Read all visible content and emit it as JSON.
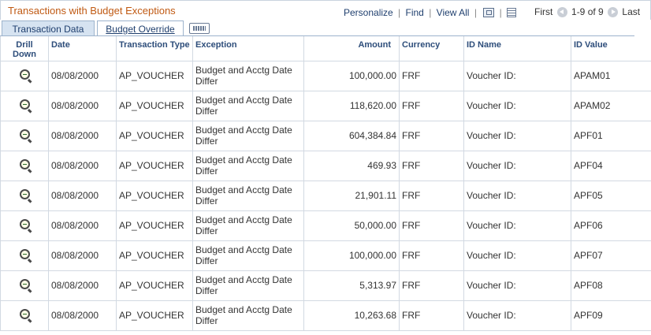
{
  "header": {
    "title": "Transactions with Budget Exceptions",
    "personalize": "Personalize",
    "find": "Find",
    "view_all": "View All",
    "first": "First",
    "range": "1-9 of 9",
    "last": "Last"
  },
  "tabs": [
    {
      "label": "Transaction Data"
    },
    {
      "label": "Budget Override"
    }
  ],
  "columns": {
    "drill": "Drill Down",
    "date": "Date",
    "type": "Transaction Type",
    "exception": "Exception",
    "amount": "Amount",
    "currency": "Currency",
    "id_name": "ID Name",
    "id_value": "ID Value"
  },
  "rows": [
    {
      "date": "08/08/2000",
      "type": "AP_VOUCHER",
      "exception": "Budget and Acctg Date Differ",
      "amount": "100,000.00",
      "currency": "FRF",
      "id_name": "Voucher ID:",
      "id_value": "APAM01"
    },
    {
      "date": "08/08/2000",
      "type": "AP_VOUCHER",
      "exception": "Budget and Acctg Date Differ",
      "amount": "118,620.00",
      "currency": "FRF",
      "id_name": "Voucher ID:",
      "id_value": "APAM02"
    },
    {
      "date": "08/08/2000",
      "type": "AP_VOUCHER",
      "exception": "Budget and Acctg Date Differ",
      "amount": "604,384.84",
      "currency": "FRF",
      "id_name": "Voucher ID:",
      "id_value": "APF01"
    },
    {
      "date": "08/08/2000",
      "type": "AP_VOUCHER",
      "exception": "Budget and Acctg Date Differ",
      "amount": "469.93",
      "currency": "FRF",
      "id_name": "Voucher ID:",
      "id_value": "APF04"
    },
    {
      "date": "08/08/2000",
      "type": "AP_VOUCHER",
      "exception": "Budget and Acctg Date Differ",
      "amount": "21,901.11",
      "currency": "FRF",
      "id_name": "Voucher ID:",
      "id_value": "APF05"
    },
    {
      "date": "08/08/2000",
      "type": "AP_VOUCHER",
      "exception": "Budget and Acctg Date Differ",
      "amount": "50,000.00",
      "currency": "FRF",
      "id_name": "Voucher ID:",
      "id_value": "APF06"
    },
    {
      "date": "08/08/2000",
      "type": "AP_VOUCHER",
      "exception": "Budget and Acctg Date Differ",
      "amount": "100,000.00",
      "currency": "FRF",
      "id_name": "Voucher ID:",
      "id_value": "APF07"
    },
    {
      "date": "08/08/2000",
      "type": "AP_VOUCHER",
      "exception": "Budget and Acctg Date Differ",
      "amount": "5,313.97",
      "currency": "FRF",
      "id_name": "Voucher ID:",
      "id_value": "APF08"
    },
    {
      "date": "08/08/2000",
      "type": "AP_VOUCHER",
      "exception": "Budget and Acctg Date Differ",
      "amount": "10,263.68",
      "currency": "FRF",
      "id_name": "Voucher ID:",
      "id_value": "APF09"
    }
  ],
  "icons": {
    "drill": "magnifier-zoom-icon",
    "zoom_grid": "zoom-grid-icon",
    "download": "download-grid-icon",
    "show_all_columns": "show-all-columns-icon",
    "prev": "prev-arrow-icon",
    "next": "next-arrow-icon"
  },
  "colors": {
    "title": "#c05a13",
    "link": "#1f3f6e",
    "header_text": "#2d4d7a",
    "active_tab": "#d6e3f1"
  }
}
